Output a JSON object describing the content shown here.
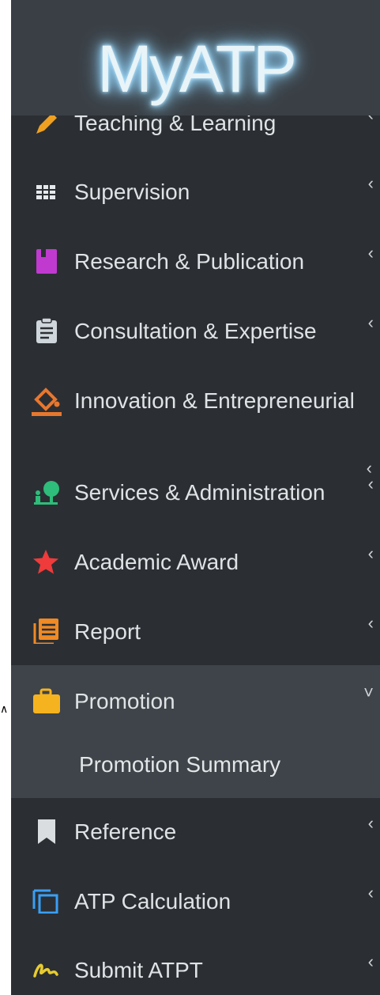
{
  "brand": {
    "logo_text": "MyATP"
  },
  "menu": {
    "items": [
      {
        "label": "Teaching & Learning",
        "icon": "pencil-icon",
        "color": "#f0a020",
        "chevron": "‹"
      },
      {
        "label": "Supervision",
        "icon": "grid-icon",
        "color": "#e6e9ec",
        "chevron": "‹"
      },
      {
        "label": "Research & Publication",
        "icon": "book-icon",
        "color": "#c03ad0",
        "chevron": "‹"
      },
      {
        "label": "Consultation & Expertise",
        "icon": "clipboard-icon",
        "color": "#cfd6dc",
        "chevron": "‹"
      },
      {
        "label": "Innovation & Entrepreneurial",
        "icon": "paint-bucket-icon",
        "color": "#e8772e",
        "chevron": "‹"
      },
      {
        "label": "Services & Administration",
        "icon": "person-tree-icon",
        "color": "#2ebd7a",
        "chevron": "‹"
      },
      {
        "label": "Academic Award",
        "icon": "star-icon",
        "color": "#ef3b3b",
        "chevron": "‹"
      },
      {
        "label": "Report",
        "icon": "report-icon",
        "color": "#f08a24",
        "chevron": "‹"
      },
      {
        "label": "Promotion",
        "icon": "briefcase-icon",
        "color": "#f5b31f",
        "chevron": "˅"
      },
      {
        "label": "Reference",
        "icon": "bookmark-icon",
        "color": "#d9dde0",
        "chevron": "‹"
      },
      {
        "label": "ATP Calculation",
        "icon": "copy-icon",
        "color": "#3a9ff5",
        "chevron": "‹"
      },
      {
        "label": "Submit ATPT",
        "icon": "signature-icon",
        "color": "#e8cc2f",
        "chevron": "‹"
      }
    ],
    "promotion_sub": {
      "label": "Promotion Summary"
    }
  },
  "cursor_char": "∧"
}
